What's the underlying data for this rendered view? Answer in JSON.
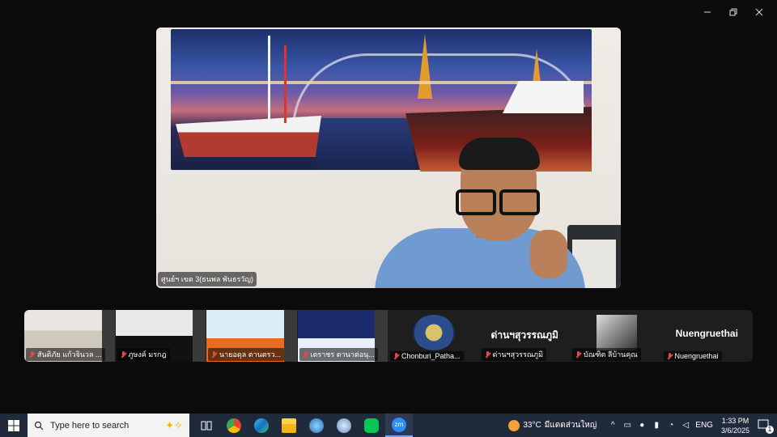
{
  "main_speaker": {
    "name": "ศูนย์ฯ เขต 3(ธนพล พันธรวัญ)"
  },
  "gallery": [
    {
      "name": "สันติภัย แก้วจินวล ...",
      "type": "video"
    },
    {
      "name": "ภูษงค์ มรกฎ",
      "type": "video"
    },
    {
      "name": "นายอดุล ตานตรว...",
      "type": "video"
    },
    {
      "name": "เตราชร ตานาต่อนุ...",
      "type": "video"
    },
    {
      "name": "Chonburi_Patha...",
      "type": "logo"
    },
    {
      "name": "ด่านฯสุวรรณภูมิ",
      "type": "text",
      "display_text": "ด่านฯสุวรรณภูมิ"
    },
    {
      "name": "บัณฑิต ลีบ้านคุณ",
      "type": "image"
    },
    {
      "name": "Nuengruethai",
      "type": "text",
      "display_text": "Nuengruethai"
    }
  ],
  "taskbar": {
    "search_placeholder": "Type here to search",
    "apps": [
      "task-view",
      "chrome",
      "edge",
      "file-explorer",
      "search-app",
      "network-app",
      "line",
      "zoom"
    ],
    "active_app": "zoom",
    "weather_temp": "33°C",
    "weather_text": "มีแดดส่วนใหญ่",
    "language": "ENG",
    "time": "1:33 PM",
    "date": "3/6/2025",
    "notification_count": "1"
  },
  "colors": {
    "background": "#0b0b0b",
    "taskbar": "#1f2a3b",
    "muted_mic": "#e34848"
  }
}
